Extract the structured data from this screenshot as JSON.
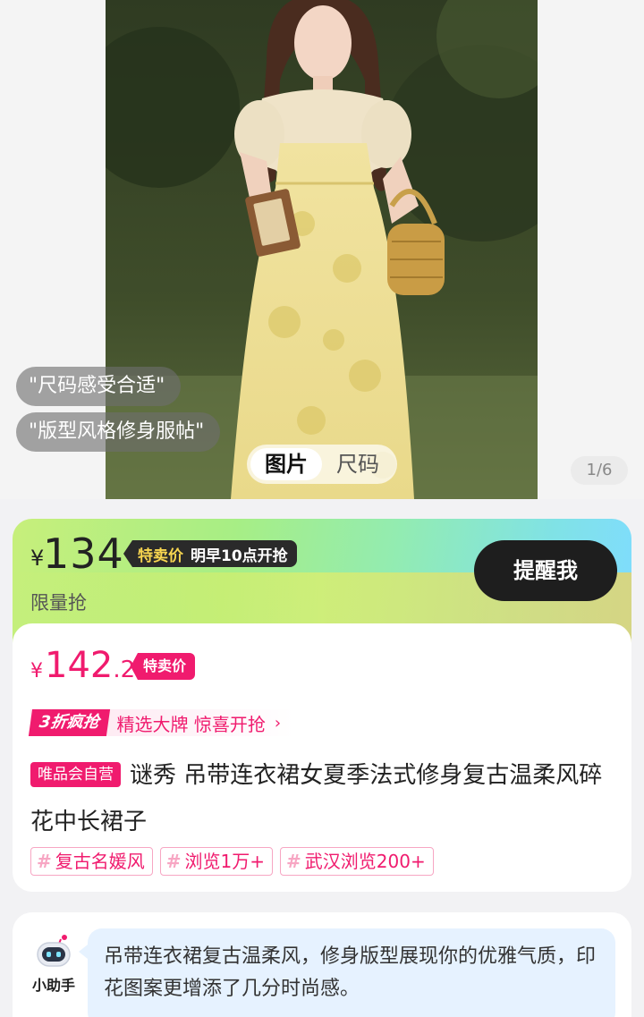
{
  "gallery": {
    "bubbles": [
      "\"尺码感受合适\"",
      "\"版型风格修身服帖\""
    ],
    "tabs": [
      "图片",
      "尺码"
    ],
    "active_tab": "图片",
    "pager": "1/6"
  },
  "flash": {
    "currency": "¥",
    "price": "134",
    "tag_key": "特卖价",
    "tag_value": "明早10点开抢",
    "limited_label": "限量抢",
    "remind_button": "提醒我"
  },
  "product": {
    "currency": "¥",
    "price_int": "142",
    "price_dec": ".2",
    "price_tag": "特卖价",
    "promo_badge": "3折疯抢",
    "promo_text": "精选大牌 惊喜开抢",
    "self_badge": "唯品会自营",
    "title": "谜秀 吊带连衣裙女夏季法式修身复古温柔风碎花中长裙子",
    "tags": [
      "复古名媛风",
      "浏览1万+",
      "武汉浏览200+"
    ]
  },
  "assistant": {
    "name": "小助手",
    "message": "吊带连衣裙复古温柔风，修身版型展现你的优雅气质，印花图案更增添了几分时尚感。"
  },
  "colors": {
    "accent": "#f01b6e",
    "dark": "#1e1e1e"
  },
  "icons": {
    "promo_chevron": "chevron-right-icon",
    "tag_hash": "hash-icon",
    "bot": "robot-icon"
  }
}
